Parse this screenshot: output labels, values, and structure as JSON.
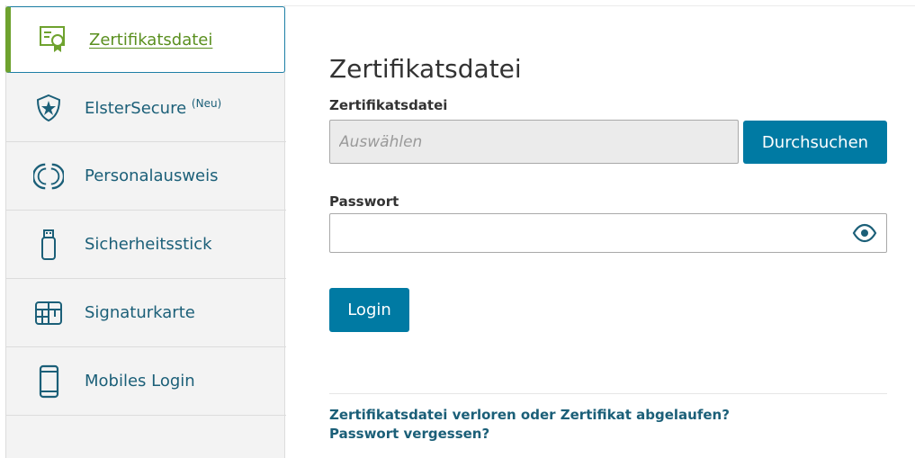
{
  "sidebar": {
    "items": [
      {
        "label": "Zertifikatsdatei",
        "icon": "certificate-icon",
        "active": true
      },
      {
        "label": "ElsterSecure",
        "badge": "(Neu)",
        "icon": "shield-star-icon"
      },
      {
        "label": "Personalausweis",
        "icon": "id-card-circle-icon"
      },
      {
        "label": "Sicherheitsstick",
        "icon": "usb-stick-icon"
      },
      {
        "label": "Signaturkarte",
        "icon": "signature-card-icon"
      },
      {
        "label": "Mobiles Login",
        "icon": "mobile-phone-icon"
      }
    ]
  },
  "main": {
    "title": "Zertifikatsdatei",
    "file_field": {
      "label": "Zertifikatsdatei",
      "placeholder": "Auswählen",
      "value": ""
    },
    "browse_button": "Durchsuchen",
    "password_field": {
      "label": "Passwort",
      "value": "",
      "toggle_icon": "eye-icon"
    },
    "login_button": "Login",
    "links": {
      "lost_certificate": "Zertifikatsdatei verloren oder Zertifikat abgelaufen?",
      "forgot_password": "Passwort vergessen?"
    }
  },
  "colors": {
    "accent_blue": "#007aa3",
    "active_green": "#6ea22e",
    "link_color": "#1b5f78",
    "sidebar_bg": "#f3f3f3"
  }
}
